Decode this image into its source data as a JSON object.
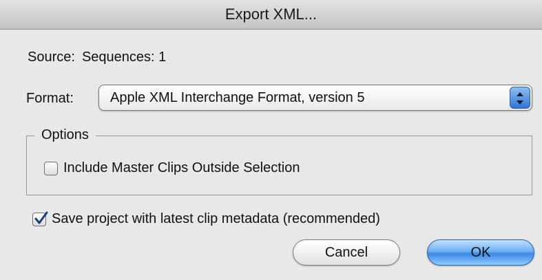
{
  "window": {
    "title": "Export XML..."
  },
  "source": {
    "label": "Source:",
    "value": "Sequences: 1"
  },
  "format": {
    "label": "Format:",
    "selected": "Apple XML Interchange Format, version 5"
  },
  "options": {
    "legend": "Options",
    "include_master_clips": {
      "label": "Include Master Clips Outside Selection",
      "checked": false
    }
  },
  "save_project": {
    "label": "Save project with latest clip metadata (recommended)",
    "checked": true
  },
  "buttons": {
    "cancel": "Cancel",
    "ok": "OK"
  },
  "colors": {
    "accent": "#3b87e6",
    "background": "#e8e8e8"
  }
}
